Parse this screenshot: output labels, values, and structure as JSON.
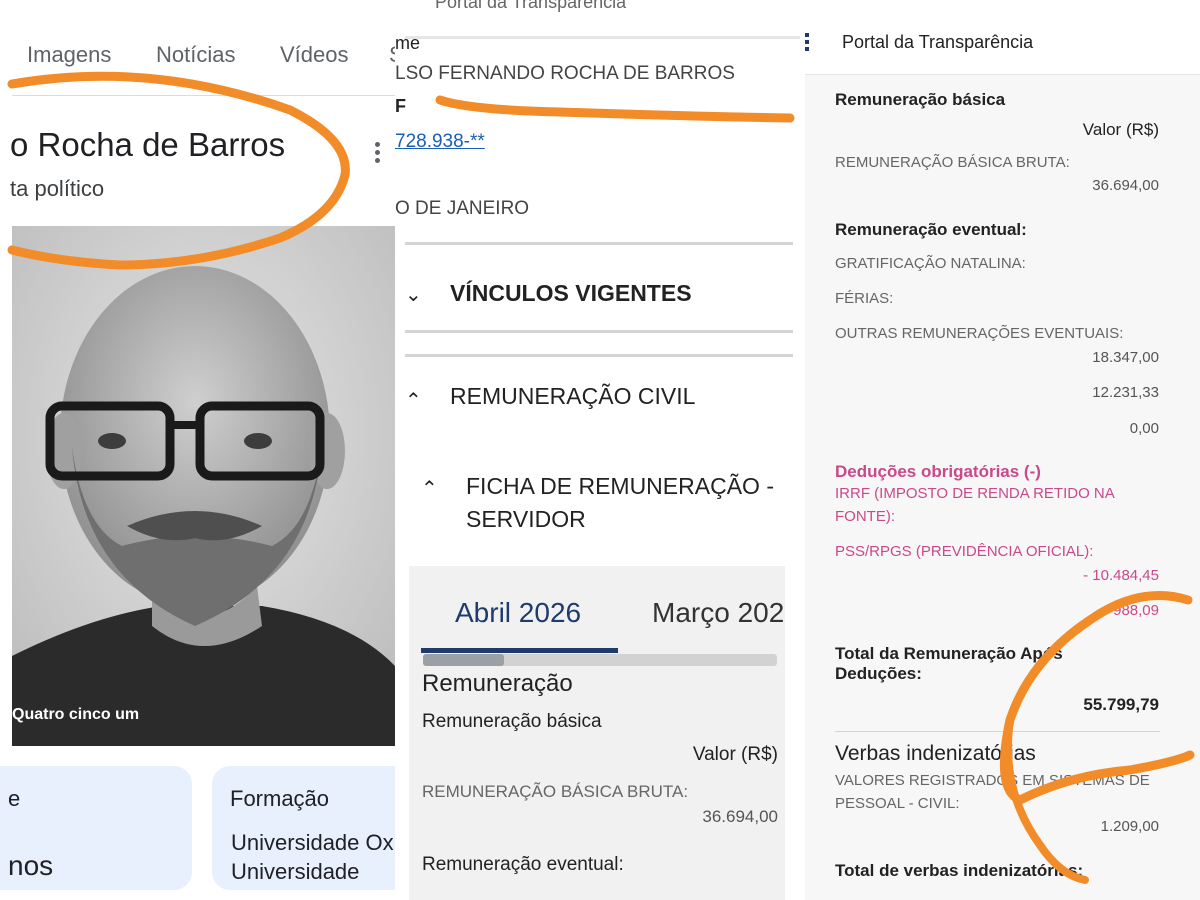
{
  "panel1": {
    "tabs": [
      "Imagens",
      "Notícias",
      "Vídeos",
      "S"
    ],
    "title": "o Rocha de Barros",
    "subtitle": "ta político",
    "photo_caption": "Quatro cinco um",
    "card_left": {
      "title": "e",
      "text": "nos"
    },
    "card_right": {
      "title": "Formação",
      "line1": "Universidade Ox",
      "line2": "Universidade"
    }
  },
  "panel2": {
    "top_text": "Portal da Transparência",
    "label_name": "me",
    "name": "LSO FERNANDO ROCHA DE BARROS",
    "label_cpf": "F",
    "cpf": "728.938-**",
    "city": "O DE JANEIRO",
    "section_vinculos": "VÍNCULOS VIGENTES",
    "section_remuneracao": "REMUNERAÇÃO CIVIL",
    "ficha_line1": "FICHA DE REMUNERAÇÃO -",
    "ficha_line2": "SERVIDOR",
    "tab_active": "Abril 2026",
    "tab_next": "Março 202",
    "progress_fraction": 0.23,
    "remuneracao_heading": "Remuneração",
    "remuneracao_basica": "Remuneração básica",
    "valor_label": "Valor (R$)",
    "basica_bruta_label": "REMUNERAÇÃO BÁSICA BRUTA:",
    "basica_bruta_value": "36.694,00",
    "eventual_heading": "Remuneração eventual:"
  },
  "panel3": {
    "header_title": "Portal da Transparência",
    "remuneracao_basica": "Remuneração básica",
    "valor_label": "Valor (R$)",
    "basica_bruta_label": "REMUNERAÇÃO BÁSICA BRUTA:",
    "basica_bruta_value": "36.694,00",
    "eventual_heading": "Remuneração eventual:",
    "gratificacao_label": "GRATIFICAÇÃO NATALINA:",
    "ferias_label": "FÉRIAS:",
    "outras_label": "OUTRAS REMUNERAÇÕES EVENTUAIS:",
    "eventual_values": [
      "18.347,00",
      "12.231,33",
      "0,00"
    ],
    "deducoes_heading": "Deduções obrigatórias (-)",
    "irrf_line1": "IRRF (IMPOSTO DE RENDA RETIDO NA",
    "irrf_line2": "FONTE):",
    "pss_label": "PSS/RPGS (PREVIDÊNCIA OFICIAL):",
    "deducoes_values": [
      "- 10.484,45",
      "- 988,09"
    ],
    "total_line1": "Total da Remuneração Após",
    "total_line2": "Deduções:",
    "total_value": "55.799,79",
    "verbas_heading": "Verbas indenizatórias",
    "valores_line1": "VALORES REGISTRADOS EM SISTEMAS DE",
    "valores_line2": "PESSOAL - CIVIL:",
    "valores_value": "1.209,00",
    "total_verbas": "Total de verbas indenizatórias:"
  },
  "colors": {
    "annotation": "#f28c28",
    "brand_blue": "#1f3b6e",
    "deduction_pink": "#c9498a",
    "card_blue": "#e8f0fe"
  }
}
